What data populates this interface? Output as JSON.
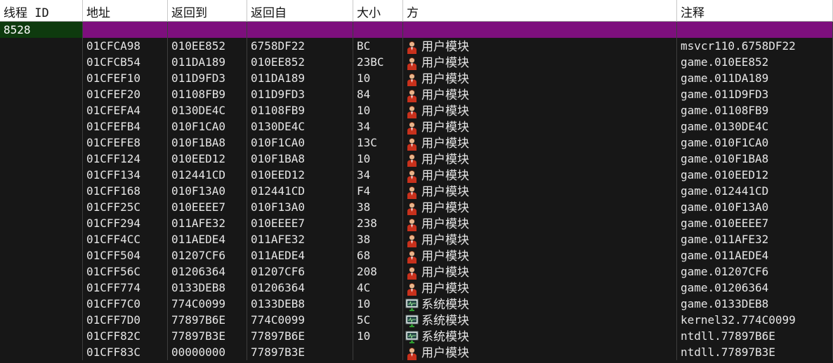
{
  "columns": [
    "线程 ID",
    "地址",
    "返回到",
    "返回自",
    "大小",
    "方",
    "注释"
  ],
  "thread": {
    "id": "8528"
  },
  "colors": {
    "thread_row": "#7d0f7d",
    "thread_id_bg": "#0e3a0e",
    "body_bg": "#171717",
    "header_bg": "#ffffff"
  },
  "rows": [
    {
      "addr": "01CFCA98",
      "ret_to": "010EE852",
      "ret_from": "6758DF22",
      "size": "BC",
      "module_icon": "user-module-icon",
      "module": "用户模块",
      "comment": "msvcr110.6758DF22"
    },
    {
      "addr": "01CFCB54",
      "ret_to": "011DA189",
      "ret_from": "010EE852",
      "size": "23BC",
      "module_icon": "user-module-icon",
      "module": "用户模块",
      "comment": "game.010EE852"
    },
    {
      "addr": "01CFEF10",
      "ret_to": "011D9FD3",
      "ret_from": "011DA189",
      "size": "10",
      "module_icon": "user-module-icon",
      "module": "用户模块",
      "comment": "game.011DA189"
    },
    {
      "addr": "01CFEF20",
      "ret_to": "01108FB9",
      "ret_from": "011D9FD3",
      "size": "84",
      "module_icon": "user-module-icon",
      "module": "用户模块",
      "comment": "game.011D9FD3"
    },
    {
      "addr": "01CFEFA4",
      "ret_to": "0130DE4C",
      "ret_from": "01108FB9",
      "size": "10",
      "module_icon": "user-module-icon",
      "module": "用户模块",
      "comment": "game.01108FB9"
    },
    {
      "addr": "01CFEFB4",
      "ret_to": "010F1CA0",
      "ret_from": "0130DE4C",
      "size": "34",
      "module_icon": "user-module-icon",
      "module": "用户模块",
      "comment": "game.0130DE4C"
    },
    {
      "addr": "01CFEFE8",
      "ret_to": "010F1BA8",
      "ret_from": "010F1CA0",
      "size": "13C",
      "module_icon": "user-module-icon",
      "module": "用户模块",
      "comment": "game.010F1CA0"
    },
    {
      "addr": "01CFF124",
      "ret_to": "010EED12",
      "ret_from": "010F1BA8",
      "size": "10",
      "module_icon": "user-module-icon",
      "module": "用户模块",
      "comment": "game.010F1BA8"
    },
    {
      "addr": "01CFF134",
      "ret_to": "012441CD",
      "ret_from": "010EED12",
      "size": "34",
      "module_icon": "user-module-icon",
      "module": "用户模块",
      "comment": "game.010EED12"
    },
    {
      "addr": "01CFF168",
      "ret_to": "010F13A0",
      "ret_from": "012441CD",
      "size": "F4",
      "module_icon": "user-module-icon",
      "module": "用户模块",
      "comment": "game.012441CD"
    },
    {
      "addr": "01CFF25C",
      "ret_to": "010EEEE7",
      "ret_from": "010F13A0",
      "size": "38",
      "module_icon": "user-module-icon",
      "module": "用户模块",
      "comment": "game.010F13A0"
    },
    {
      "addr": "01CFF294",
      "ret_to": "011AFE32",
      "ret_from": "010EEEE7",
      "size": "238",
      "module_icon": "user-module-icon",
      "module": "用户模块",
      "comment": "game.010EEEE7"
    },
    {
      "addr": "01CFF4CC",
      "ret_to": "011AEDE4",
      "ret_from": "011AFE32",
      "size": "38",
      "module_icon": "user-module-icon",
      "module": "用户模块",
      "comment": "game.011AFE32"
    },
    {
      "addr": "01CFF504",
      "ret_to": "01207CF6",
      "ret_from": "011AEDE4",
      "size": "68",
      "module_icon": "user-module-icon",
      "module": "用户模块",
      "comment": "game.011AEDE4"
    },
    {
      "addr": "01CFF56C",
      "ret_to": "01206364",
      "ret_from": "01207CF6",
      "size": "208",
      "module_icon": "user-module-icon",
      "module": "用户模块",
      "comment": "game.01207CF6"
    },
    {
      "addr": "01CFF774",
      "ret_to": "0133DEB8",
      "ret_from": "01206364",
      "size": "4C",
      "module_icon": "user-module-icon",
      "module": "用户模块",
      "comment": "game.01206364"
    },
    {
      "addr": "01CFF7C0",
      "ret_to": "774C0099",
      "ret_from": "0133DEB8",
      "size": "10",
      "module_icon": "system-module-icon",
      "module": "系统模块",
      "comment": "game.0133DEB8"
    },
    {
      "addr": "01CFF7D0",
      "ret_to": "77897B6E",
      "ret_from": "774C0099",
      "size": "5C",
      "module_icon": "system-module-icon",
      "module": "系统模块",
      "comment": "kernel32.774C0099"
    },
    {
      "addr": "01CFF82C",
      "ret_to": "77897B3E",
      "ret_from": "77897B6E",
      "size": "10",
      "module_icon": "system-module-icon",
      "module": "系统模块",
      "comment": "ntdll.77897B6E"
    },
    {
      "addr": "01CFF83C",
      "ret_to": "00000000",
      "ret_from": "77897B3E",
      "size": "",
      "module_icon": "user-module-icon",
      "module": "用户模块",
      "comment": "ntdll.77897B3E"
    }
  ]
}
